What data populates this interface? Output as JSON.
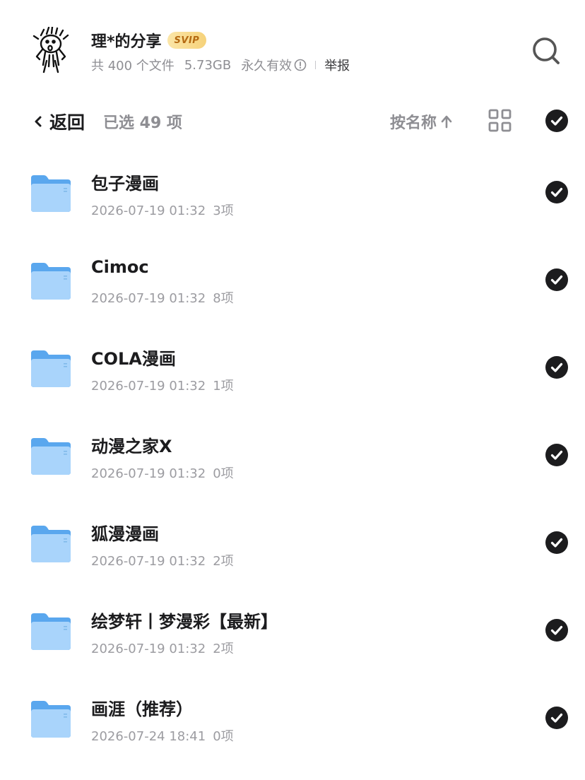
{
  "header": {
    "owner_name": "理*的分享",
    "badge": "SVIP",
    "file_count": "共 400 个文件",
    "total_size": "5.73GB",
    "validity": "永久有效",
    "report_label": "举报",
    "icons": {
      "avatar": "doodle-avatar",
      "info": "info-circle-icon",
      "search": "search-icon"
    }
  },
  "toolbar": {
    "back_label": "返回",
    "selected_label": "已选 49 项",
    "sort_label": "按名称",
    "icons": {
      "back": "chevron-left-icon",
      "sort": "arrow-up-icon",
      "view_toggle": "grid-view-icon",
      "select_all": "check-circle-icon"
    }
  },
  "files": [
    {
      "name": "包子漫画",
      "date": "2026-07-19 01:32",
      "count": "3项",
      "selected": true
    },
    {
      "name": "Cimoc",
      "date": "2026-07-19 01:32",
      "count": "8项",
      "selected": true
    },
    {
      "name": "COLA漫画",
      "date": "2026-07-19 01:32",
      "count": "1项",
      "selected": true
    },
    {
      "name": "动漫之家X",
      "date": "2026-07-19 01:32",
      "count": "0项",
      "selected": true
    },
    {
      "name": "狐漫漫画",
      "date": "2026-07-19 01:32",
      "count": "2项",
      "selected": true
    },
    {
      "name": "绘梦轩丨梦漫彩【最新】",
      "date": "2026-07-19 01:32",
      "count": "2项",
      "selected": true
    },
    {
      "name": "画涯（推荐）",
      "date": "2026-07-24 18:41",
      "count": "0项",
      "selected": true
    }
  ],
  "colors": {
    "text_primary": "#1c1c1e",
    "text_secondary": "#8e8e93",
    "check_fill": "#1c1c1e",
    "folder_back": "#5aa7ee",
    "folder_front": "#a9d4fb",
    "svip_text": "#b56a12"
  }
}
